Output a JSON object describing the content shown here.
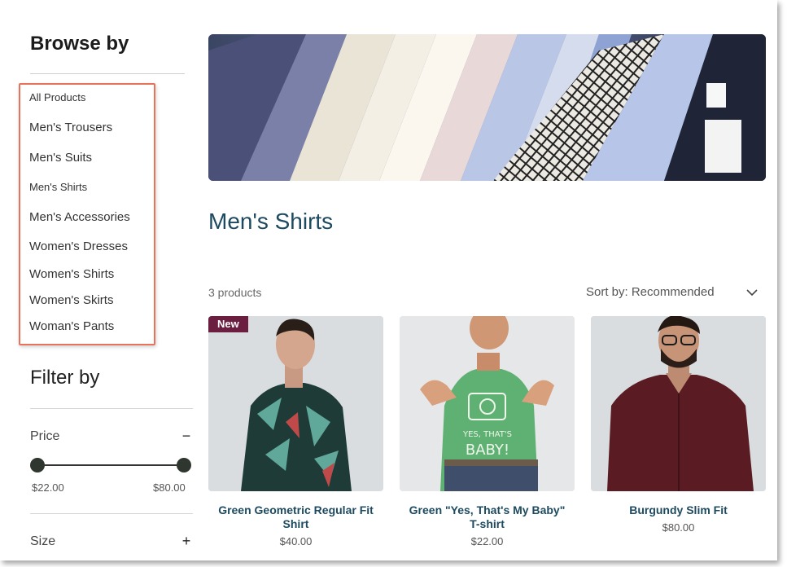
{
  "sidebar": {
    "browse_title": "Browse by",
    "categories": [
      "All Products",
      "Men's Trousers",
      "Men's Suits",
      "Men's Shirts",
      "Men's Accessories",
      "Women's Dresses",
      "Women's Shirts",
      "Women's Skirts",
      "Woman's Pants"
    ],
    "filter_title": "Filter by",
    "price_label": "Price",
    "price_toggle": "−",
    "price_min": "$22.00",
    "price_max": "$80.00",
    "size_label": "Size",
    "size_toggle": "+"
  },
  "main": {
    "page_title": "Men's Shirts",
    "product_count": "3 products",
    "sort_label": "Sort by: Recommended"
  },
  "products": [
    {
      "name": "Green Geometric Regular Fit Shirt",
      "price": "$40.00",
      "badge": "New"
    },
    {
      "name": "Green \"Yes, That's My Baby\" T-shirt",
      "price": "$22.00"
    },
    {
      "name": "Burgundy Slim Fit",
      "price": "$80.00"
    }
  ],
  "colors": {
    "accent_title": "#1d4a5f",
    "badge": "#6b1e3f",
    "highlight_box": "#e8735a"
  }
}
